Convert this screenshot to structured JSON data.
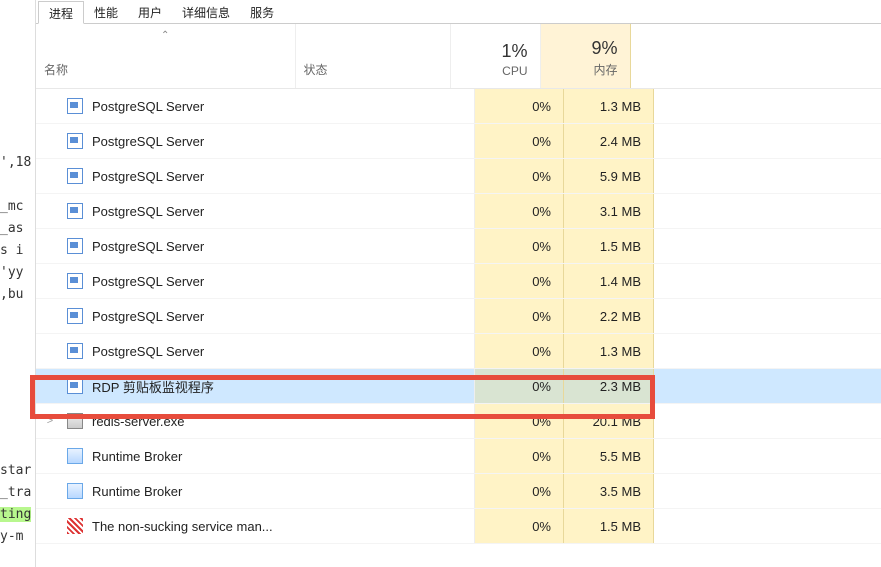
{
  "bg_editor": {
    "line1": "',18",
    "line2": "",
    "line3": "_mc",
    "line4": "_as",
    "line5": "s i",
    "line6": "'yy",
    "line7": ",bu",
    "line8": "",
    "line9": "",
    "line10": "",
    "line11": "",
    "line12": "",
    "line13": "",
    "line14": "",
    "line15": "star",
    "line16": "_tra",
    "line17": "ting",
    "line18": "y-m"
  },
  "tabs": {
    "processes": "进程",
    "performance": "性能",
    "users": "用户",
    "details": "详细信息",
    "services": "服务"
  },
  "header": {
    "name": "名称",
    "status": "状态",
    "cpu_pct": "1%",
    "cpu_label": "CPU",
    "mem_pct": "9%",
    "mem_label": "内存",
    "sort_indicator": "⌃"
  },
  "rows": [
    {
      "icon": "app",
      "name": "PostgreSQL Server",
      "cpu": "0%",
      "mem": "1.3 MB",
      "expand": "",
      "selected": false
    },
    {
      "icon": "app",
      "name": "PostgreSQL Server",
      "cpu": "0%",
      "mem": "2.4 MB",
      "expand": "",
      "selected": false
    },
    {
      "icon": "app",
      "name": "PostgreSQL Server",
      "cpu": "0%",
      "mem": "5.9 MB",
      "expand": "",
      "selected": false
    },
    {
      "icon": "app",
      "name": "PostgreSQL Server",
      "cpu": "0%",
      "mem": "3.1 MB",
      "expand": "",
      "selected": false
    },
    {
      "icon": "app",
      "name": "PostgreSQL Server",
      "cpu": "0%",
      "mem": "1.5 MB",
      "expand": "",
      "selected": false
    },
    {
      "icon": "app",
      "name": "PostgreSQL Server",
      "cpu": "0%",
      "mem": "1.4 MB",
      "expand": "",
      "selected": false
    },
    {
      "icon": "app",
      "name": "PostgreSQL Server",
      "cpu": "0%",
      "mem": "2.2 MB",
      "expand": "",
      "selected": false
    },
    {
      "icon": "app",
      "name": "PostgreSQL Server",
      "cpu": "0%",
      "mem": "1.3 MB",
      "expand": "",
      "selected": false
    },
    {
      "icon": "app",
      "name": "RDP 剪贴板监视程序",
      "cpu": "0%",
      "mem": "2.3 MB",
      "expand": "",
      "selected": true
    },
    {
      "icon": "redis",
      "name": "redis-server.exe",
      "cpu": "0%",
      "mem": "20.1 MB",
      "expand": ">",
      "selected": false
    },
    {
      "icon": "broker",
      "name": "Runtime Broker",
      "cpu": "0%",
      "mem": "5.5 MB",
      "expand": "",
      "selected": false
    },
    {
      "icon": "broker",
      "name": "Runtime Broker",
      "cpu": "0%",
      "mem": "3.5 MB",
      "expand": "",
      "selected": false
    },
    {
      "icon": "nss",
      "name": "The non-sucking service man...",
      "cpu": "0%",
      "mem": "1.5 MB",
      "expand": "",
      "selected": false
    }
  ]
}
